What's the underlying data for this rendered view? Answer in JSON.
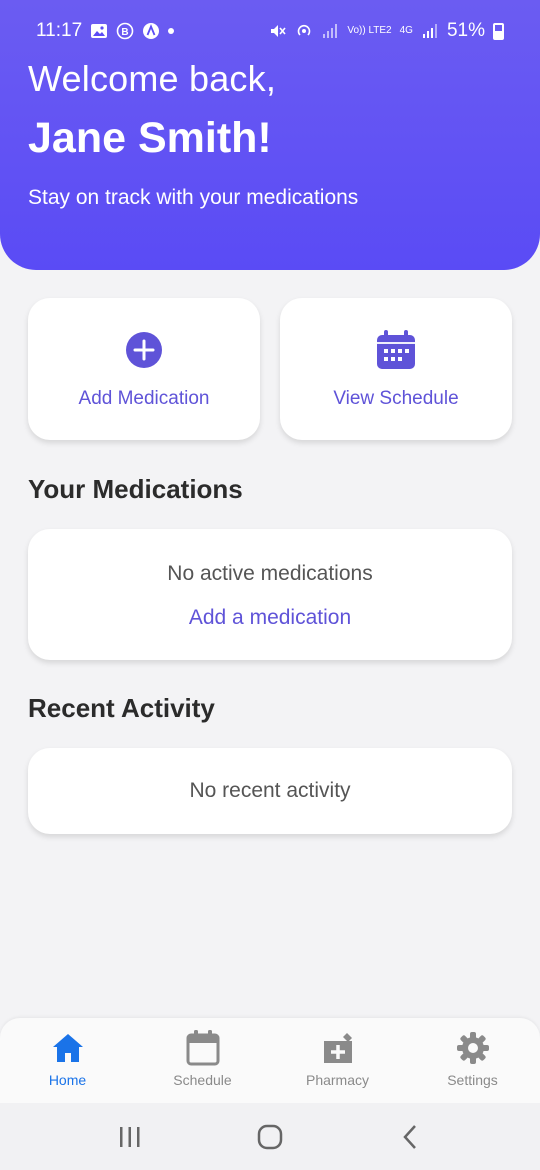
{
  "status_bar": {
    "time": "11:17",
    "battery": "51%",
    "left_icons": [
      "gallery-icon",
      "b-circle-icon",
      "a-circle-icon",
      "dot-icon"
    ],
    "right_icons": [
      "mute-icon",
      "hotspot-icon",
      "signal-icon",
      "volte-icon",
      "4g-icon",
      "signal-icon",
      "battery-icon"
    ],
    "volte_label": "Vo)) LTE2",
    "net_label": "4G"
  },
  "header": {
    "welcome": "Welcome back,",
    "username": "Jane Smith!",
    "tagline": "Stay on track with your medications"
  },
  "actions": {
    "add_label": "Add Medication",
    "view_label": "View Schedule"
  },
  "medications": {
    "title": "Your Medications",
    "empty_text": "No active medications",
    "add_link": "Add a medication"
  },
  "activity": {
    "title": "Recent Activity",
    "empty_text": "No recent activity"
  },
  "bottom_nav": {
    "items": [
      {
        "label": "Home",
        "icon": "home-icon",
        "active": true
      },
      {
        "label": "Schedule",
        "icon": "calendar-icon",
        "active": false
      },
      {
        "label": "Pharmacy",
        "icon": "pharmacy-icon",
        "active": false
      },
      {
        "label": "Settings",
        "icon": "gear-icon",
        "active": false
      }
    ]
  },
  "colors": {
    "header_bg": "#5a4bf5",
    "accent": "#5f53d8",
    "nav_active": "#1a73e8",
    "nav_inactive": "#8a8a8a"
  }
}
